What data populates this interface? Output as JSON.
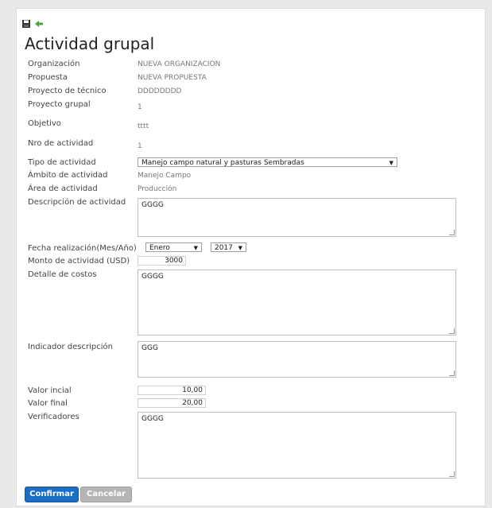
{
  "toolbar": {
    "save_icon": "save-icon",
    "back_icon": "back-arrow-icon",
    "back_color": "#4aa832"
  },
  "page": {
    "title": "Actividad grupal"
  },
  "labels": {
    "organizacion": "Organización",
    "propuesta": "Propuesta",
    "proyecto_tecnico": "Proyecto de técnico",
    "proyecto_grupal": "Proyecto grupal",
    "objetivo": "Objetivo",
    "nro_actividad": "Nro de actividad",
    "tipo_actividad": "Tipo de actividad",
    "ambito_actividad": "Ámbito de actividad",
    "area_actividad": "Área de actividad",
    "descripcion_actividad": "Descripción de actividad",
    "fecha_realizacion": "Fecha realización(Mes/Año)",
    "monto_actividad": "Monto de actividad (USD)",
    "detalle_costos": "Detalle de costos",
    "indicador_descripcion": "Indicador descripción",
    "valor_inicial": "Valor incial",
    "valor_final": "Valor final",
    "verificadores": "Verificadores"
  },
  "values": {
    "organizacion": "NUEVA ORGANIZACION",
    "propuesta": "NUEVA PROPUESTA",
    "proyecto_tecnico": "DDDDDDDD",
    "proyecto_grupal": "1",
    "objetivo": "tttt",
    "nro_actividad": "1",
    "tipo_actividad": "Manejo campo natural y pasturas Sembradas",
    "ambito_actividad": "Manejo Campo",
    "area_actividad": "Producción",
    "descripcion_actividad": "GGGG",
    "mes": "Enero",
    "anio": "2017",
    "monto_actividad": "3000",
    "detalle_costos": "GGGG",
    "indicador_descripcion": "GGG",
    "valor_inicial": "10,00",
    "valor_final": "20,00",
    "verificadores": "GGGG"
  },
  "buttons": {
    "confirmar": "Confirmar",
    "cancelar": "Cancelar"
  },
  "colors": {
    "primary": "#1a6fc4",
    "secondary": "#b5b5b5"
  }
}
